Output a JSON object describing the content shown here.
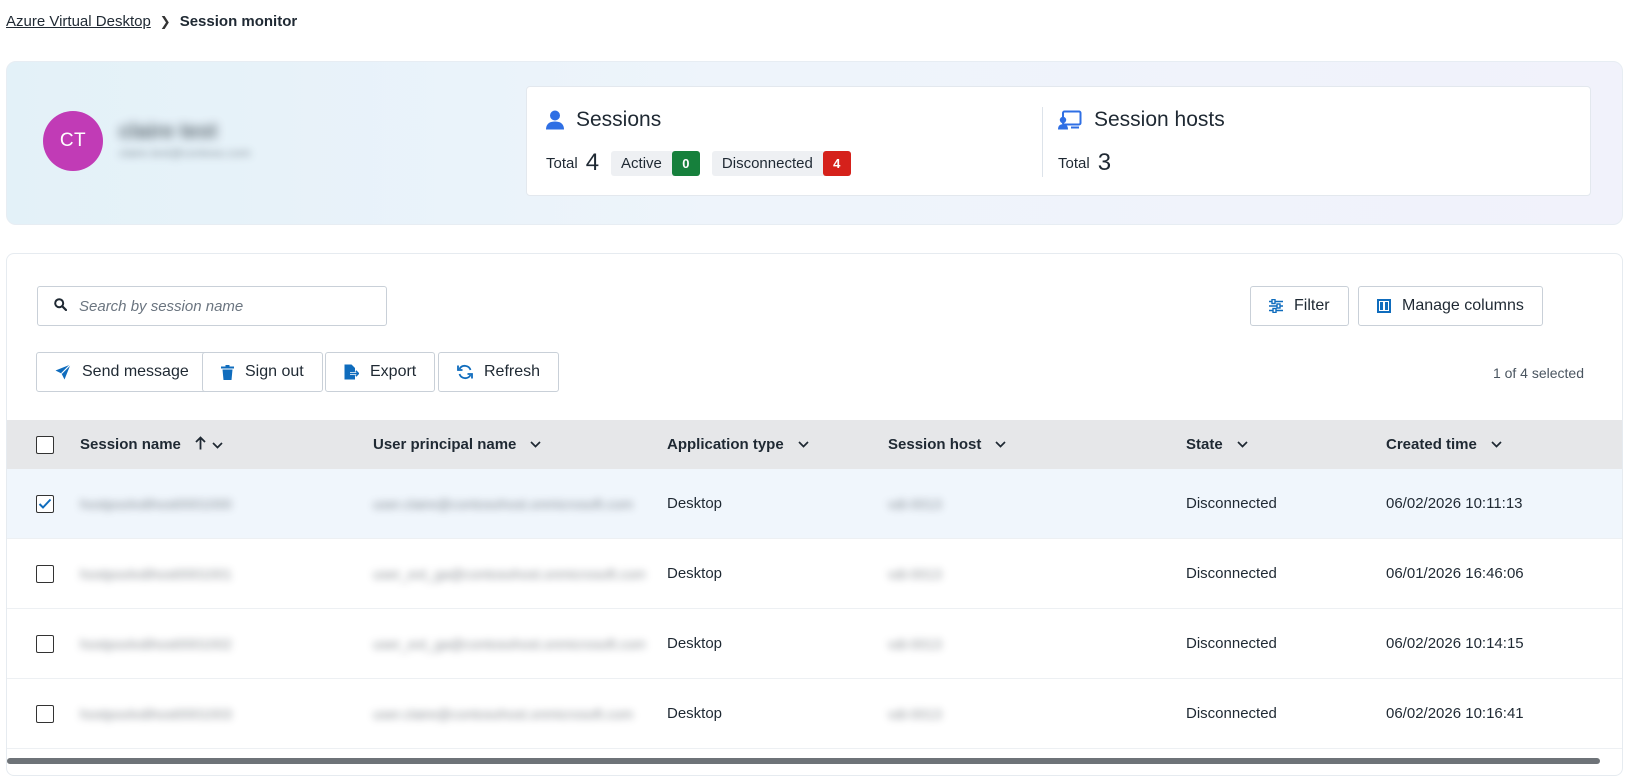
{
  "breadcrumb": {
    "parent": "Azure Virtual Desktop",
    "current": "Session monitor"
  },
  "user": {
    "initials": "CT",
    "name": "claire test",
    "subtitle": "claire.test@contoso.com",
    "avatar_color": "#c13bb6"
  },
  "sessions": {
    "title": "Sessions",
    "total_label": "Total",
    "total": "4",
    "active_label": "Active",
    "active": "0",
    "disconnected_label": "Disconnected",
    "disconnected": "4"
  },
  "hosts": {
    "title": "Session hosts",
    "total_label": "Total",
    "total": "3"
  },
  "toolbar": {
    "search_placeholder": "Search by session name",
    "filter_label": "Filter",
    "manage_columns_label": "Manage columns",
    "send_message_label": "Send message",
    "sign_out_label": "Sign out",
    "export_label": "Export",
    "refresh_label": "Refresh",
    "selection_info": "1 of 4 selected"
  },
  "table": {
    "columns": {
      "session_name": "Session name",
      "upn": "User principal name",
      "app_type": "Application type",
      "session_host": "Session host",
      "state": "State",
      "created": "Created time"
    },
    "rows": [
      {
        "selected": true,
        "name": "hostpoolvdihost0001000",
        "upn": "user.claire@contosohost.onmicrosoft.com",
        "app": "Desktop",
        "host": "vdi-0013",
        "state": "Disconnected",
        "created": "06/02/2026 10:11:13"
      },
      {
        "selected": false,
        "name": "hostpoolvdihost0001001",
        "upn": "user_ext_ga@contosohost.onmicrosoft.com",
        "app": "Desktop",
        "host": "vdi-0013",
        "state": "Disconnected",
        "created": "06/01/2026 16:46:06"
      },
      {
        "selected": false,
        "name": "hostpoolvdihost0001002",
        "upn": "user_ext_ga@contosohost.onmicrosoft.com",
        "app": "Desktop",
        "host": "vdi-0013",
        "state": "Disconnected",
        "created": "06/02/2026 10:14:15"
      },
      {
        "selected": false,
        "name": "hostpoolvdihost0001003",
        "upn": "user.claire@contosohost.onmicrosoft.com",
        "app": "Desktop",
        "host": "vdi-0013",
        "state": "Disconnected",
        "created": "06/02/2026 10:16:41"
      }
    ]
  },
  "colors": {
    "accent": "#0f6cbd",
    "active_badge": "#16803c",
    "disconnected_badge": "#d5211b"
  }
}
